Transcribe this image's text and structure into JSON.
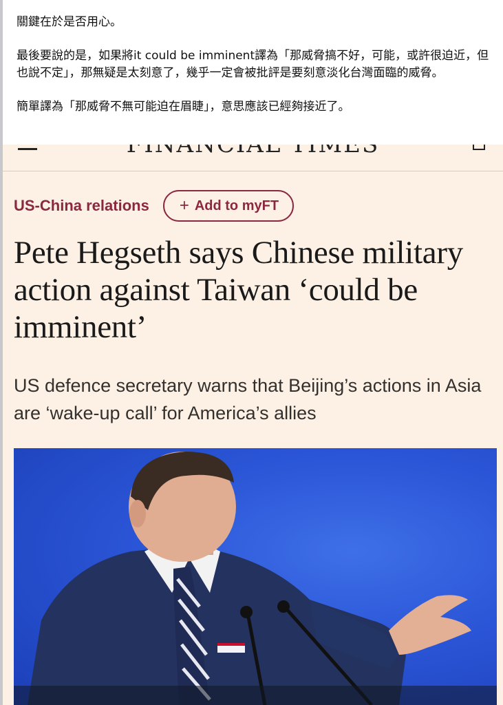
{
  "post": {
    "paragraphs": [
      "關鍵在於是否用心。",
      "最後要說的是，如果將it could be imminent譯為「那威脅搞不好，可能，或許很迫近，但也說不定」，那無疑是太刻意了，幾乎一定會被批評是要刻意淡化台灣面臨的威脅。",
      "簡單譯為「那威脅不無可能迫在眉睫」，意思應該已經夠接近了。"
    ]
  },
  "ft": {
    "masthead": "FINANCIAL TIMES",
    "topic": "US-China relations",
    "add_button": "Add to myFT",
    "headline": "Pete Hegseth says Chinese military action against Taiwan ‘could be imminent’",
    "standfirst": "US defence secretary warns that Beijing’s actions in Asia are ‘wake-up call’ for America’s allies",
    "colors": {
      "background": "#fdf1e5",
      "topic": "#8c2740",
      "photo_backdrop": "#2a55d6"
    },
    "icons": [
      "menu-icon",
      "plus-icon",
      "account-icon"
    ]
  }
}
